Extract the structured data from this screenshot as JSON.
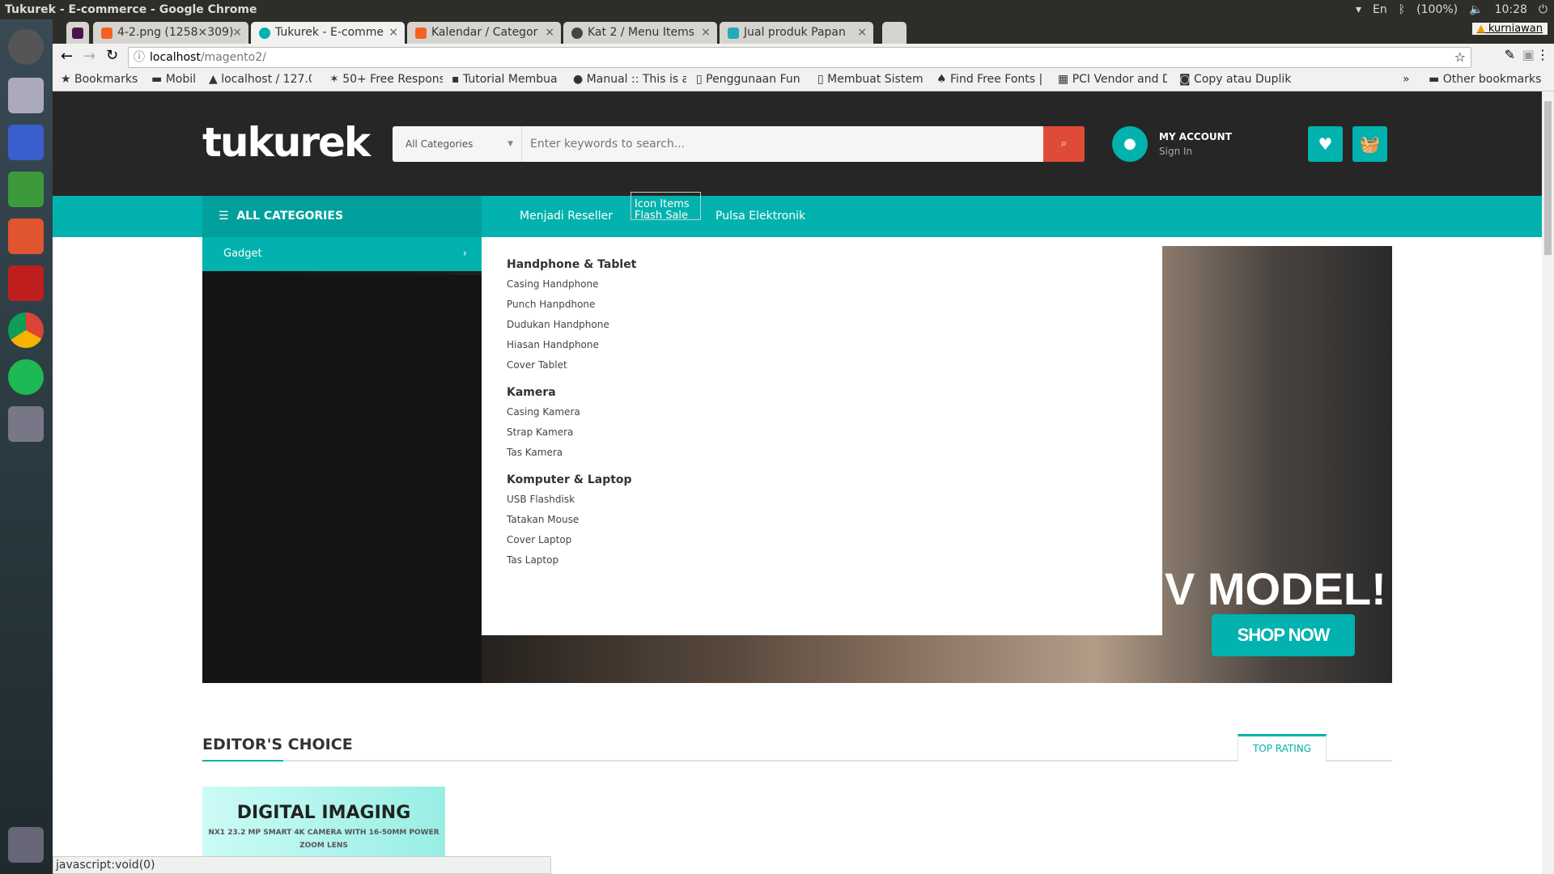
{
  "window": {
    "title": "Tukurek - E-commerce - Google Chrome",
    "tray": {
      "lang": "En",
      "battery": "(100%)",
      "time": "10:28",
      "user": "kurniawan"
    }
  },
  "tabs": [
    {
      "label": "4-2.png (1258×309)"
    },
    {
      "label": "Tukurek - E-comme"
    },
    {
      "label": "Kalendar / Categor"
    },
    {
      "label": "Kat 2 / Menu Items"
    },
    {
      "label": "Jual produk Papan"
    }
  ],
  "address": {
    "host": "localhost",
    "path": "/magento2/"
  },
  "bookmarks": [
    "Bookmarks",
    "Mobil",
    "localhost / 127.0.",
    "50+ Free Respons",
    "Tutorial Membua",
    "Manual :: This is a",
    "Penggunaan Fun",
    "Membuat Sistem",
    "Find Free Fonts |",
    "PCI Vendor and D",
    "Copy atau Duplik"
  ],
  "bookmarks_more": "»",
  "other_bookmarks": "Other bookmarks",
  "header": {
    "logo": "tukurek",
    "category_select": "All Categories",
    "search_placeholder": "Enter keywords to search...",
    "account_title": "MY ACCOUNT",
    "account_sub": "Sign In"
  },
  "nav": {
    "all_categories": "ALL CATEGORIES",
    "links": [
      "Menjadi Reseller",
      "Pulsa Elektronik"
    ],
    "broken_image_alt": "Icon Items Flash Sale"
  },
  "sidebar": {
    "active_item": "Gadget"
  },
  "mega": [
    {
      "heading": "Handphone & Tablet",
      "items": [
        "Casing Handphone",
        "Punch Hanpdhone",
        "Dudukan Handphone",
        "Hiasan Handphone",
        "Cover Tablet"
      ]
    },
    {
      "heading": "Kamera",
      "items": [
        "Casing Kamera",
        "Strap Kamera",
        "Tas Kamera"
      ]
    },
    {
      "heading": "Komputer & Laptop",
      "items": [
        "USB Flashdisk",
        "Tatakan Mouse",
        "Cover Laptop",
        "Tas Laptop"
      ]
    }
  ],
  "banner": {
    "headline": "V MODEL!",
    "cta": "SHOP NOW"
  },
  "editors": {
    "title": "EDITOR'S CHOICE",
    "tab": "TOP RATING",
    "card_title": "DIGITAL IMAGING",
    "card_sub": "NX1 23.2 MP SMART 4K CAMERA WITH 16-50MM POWER ZOOM LENS"
  },
  "status": "javascript:void(0)",
  "colors": {
    "accent": "#01b2ae",
    "search_button": "#e04b37",
    "header_bg": "#262626"
  }
}
